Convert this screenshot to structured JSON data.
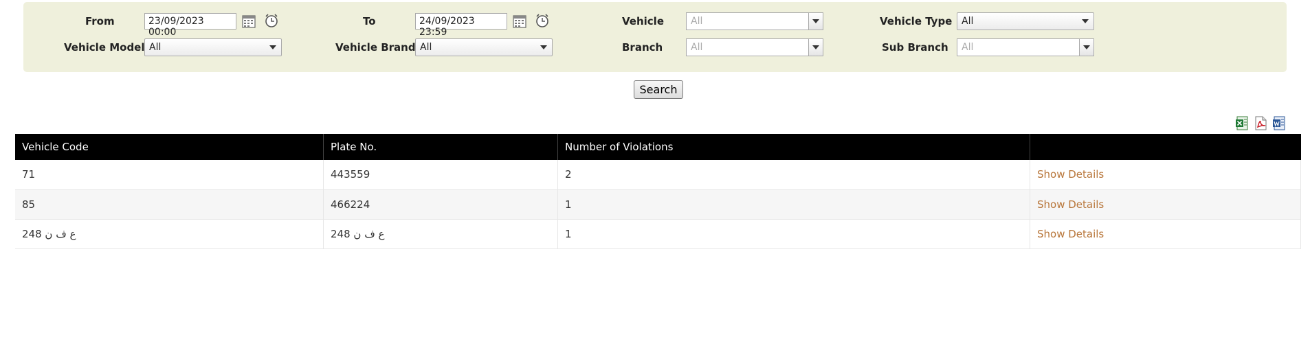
{
  "filters": {
    "from_label": "From",
    "from_value": "23/09/2023 00:00",
    "to_label": "To",
    "to_value": "24/09/2023 23:59",
    "vehicle_label": "Vehicle",
    "vehicle_value": "All",
    "vehicle_type_label": "Vehicle Type",
    "vehicle_type_value": "All",
    "vehicle_model_label": "Vehicle Model",
    "vehicle_model_value": "All",
    "vehicle_brand_label": "Vehicle Brand",
    "vehicle_brand_value": "All",
    "branch_label": "Branch",
    "branch_value": "All",
    "sub_branch_label": "Sub Branch",
    "sub_branch_value": "All"
  },
  "search_label": "Search",
  "export_icons": [
    "excel-export-icon",
    "pdf-export-icon",
    "word-export-icon"
  ],
  "table": {
    "headers": [
      "Vehicle Code",
      "Plate No.",
      "Number of Violations",
      ""
    ],
    "rows": [
      {
        "code": "71",
        "plate": "443559",
        "violations": "2",
        "action": "Show Details"
      },
      {
        "code": "85",
        "plate": "466224",
        "violations": "1",
        "action": "Show Details"
      },
      {
        "code": "ع ف ن 248",
        "plate": "ع ف ن 248",
        "violations": "1",
        "action": "Show Details"
      }
    ]
  },
  "colors": {
    "panel_bg": "#eff0dc",
    "header_bg": "#000000",
    "link": "#b8763a"
  }
}
